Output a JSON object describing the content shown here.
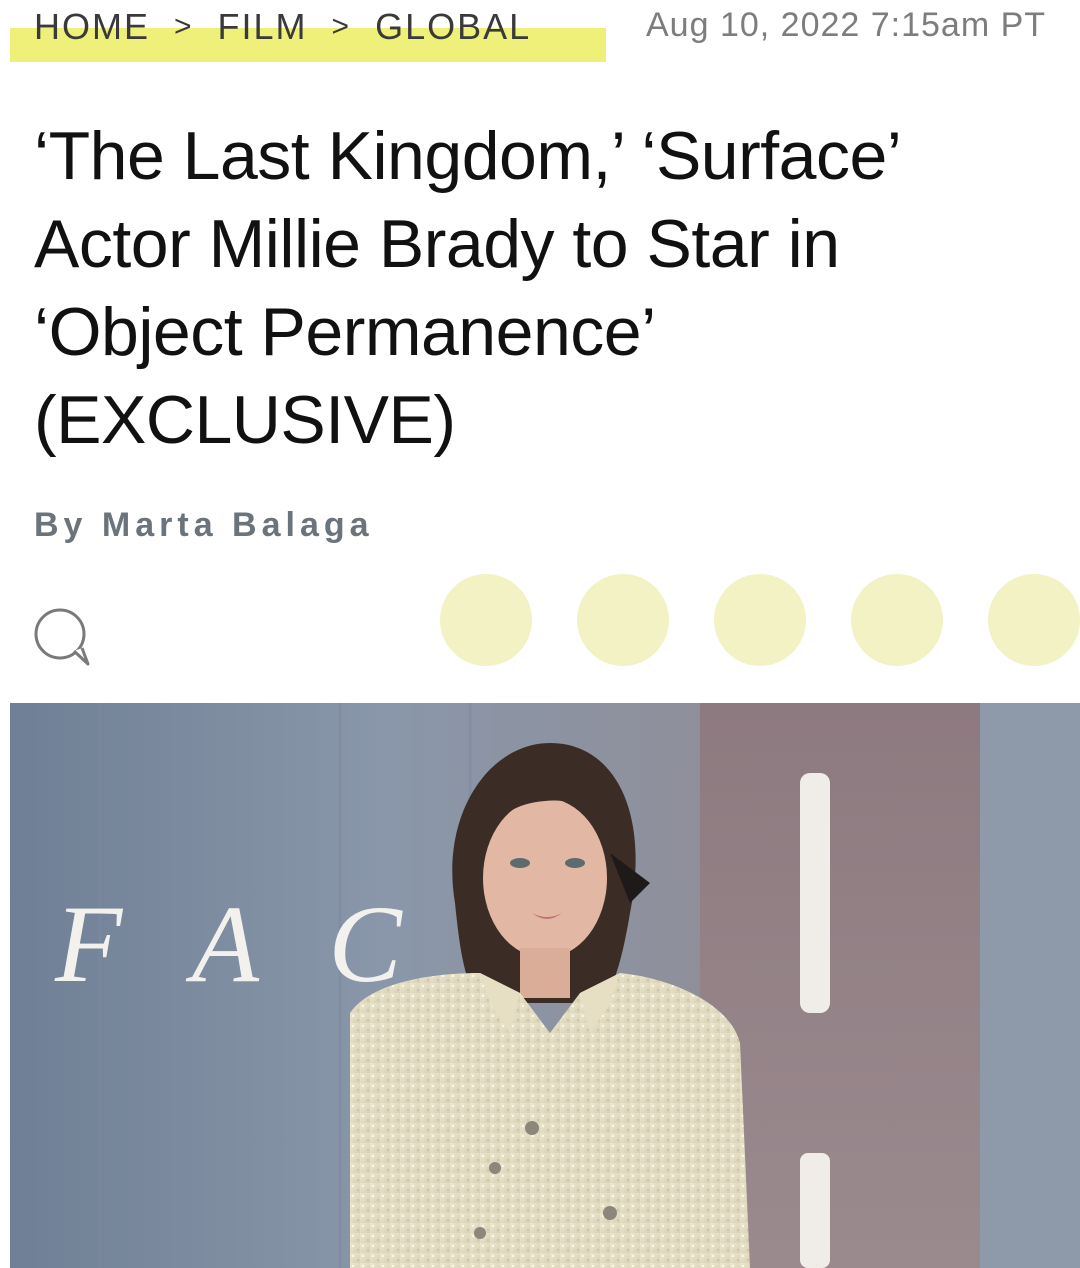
{
  "breadcrumb": {
    "items": [
      {
        "label": "HOME"
      },
      {
        "label": "FILM"
      },
      {
        "label": "GLOBAL"
      }
    ],
    "separator": ">",
    "highlight_color": "#eff07a"
  },
  "article": {
    "date": "Aug 10, 2022 7:15am PT",
    "headline_lines": [
      "‘The Last Kingdom,’ ‘Surface’",
      "Actor Millie Brady to Star in",
      "‘Object Permanence’",
      "(EXCLUSIVE)"
    ],
    "byline": "By Marta Balaga"
  },
  "actions": {
    "comment_icon": "comment-bubble-icon",
    "share_buttons": [
      {
        "icon": "share-icon"
      },
      {
        "icon": "share-icon"
      },
      {
        "icon": "share-icon"
      },
      {
        "icon": "share-icon"
      },
      {
        "icon": "share-icon"
      }
    ],
    "share_color": "#f3f2c4"
  },
  "hero": {
    "backdrop_letters": "F A C"
  }
}
